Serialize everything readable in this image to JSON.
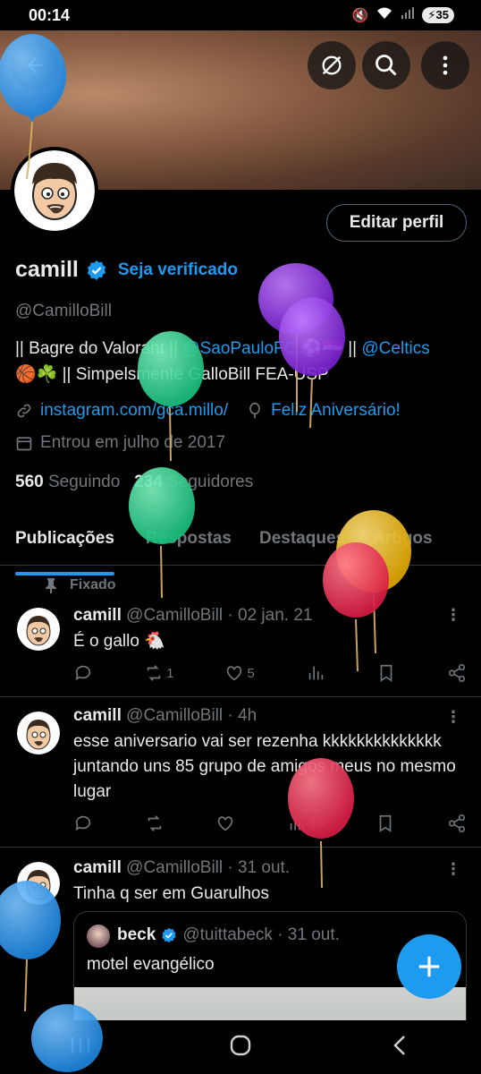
{
  "status_bar": {
    "time": "00:14",
    "battery": "35"
  },
  "header": {
    "back_icon": "arrow-left-icon",
    "buttons": [
      "grok-icon",
      "search-icon",
      "more-vertical-icon"
    ]
  },
  "profile": {
    "edit_label": "Editar perfil",
    "name": "camill",
    "verify_label": "Seja verificado",
    "handle": "@CamilloBill",
    "bio_line1_a": "|| Bagre do Valorant || ",
    "bio_line1_mention": "@SaoPauloFC",
    "bio_line1_b": " ⚽🇪🇬 || ",
    "bio_line1_mention2": "@Celtics",
    "bio_line2": "🏀☘️ || Simpelsmente GalloBill  FEA-USP",
    "link": "instagram.com/gca.millo/",
    "birthday": "Feliz Aniversário!",
    "joined": "Entrou em julho de 2017",
    "following_count": "560",
    "following_label": "Seguindo",
    "followers_count": "234",
    "followers_label": "Seguidores"
  },
  "tabs": [
    "Publicações",
    "Respostas",
    "Destaques",
    "Artigos"
  ],
  "pinned_label": "Fixado",
  "tweets": [
    {
      "name": "camill",
      "meta": "@CamilloBill · 02 jan. 21",
      "text": "É o gallo 🐔",
      "reposts": "1",
      "likes": "5",
      "views": ""
    },
    {
      "name": "camill",
      "meta": "@CamilloBill · 4h",
      "text": "esse aniversario vai ser rezenha kkkkkkkkkkkkkk juntando uns 85 grupo de amigos meus no mesmo lugar",
      "reposts": "",
      "likes": "",
      "views": "16"
    },
    {
      "name": "camill",
      "meta": "@CamilloBill · 31 out.",
      "text": "Tinha q ser em Guarulhos"
    }
  ],
  "quote": {
    "name": "beck",
    "meta": "@tuittabeck · 31 out.",
    "text": "motel evangélico"
  },
  "colors": {
    "accent": "#1d9bf0",
    "background": "#000000",
    "muted": "#71767b",
    "border": "#2f3336"
  }
}
